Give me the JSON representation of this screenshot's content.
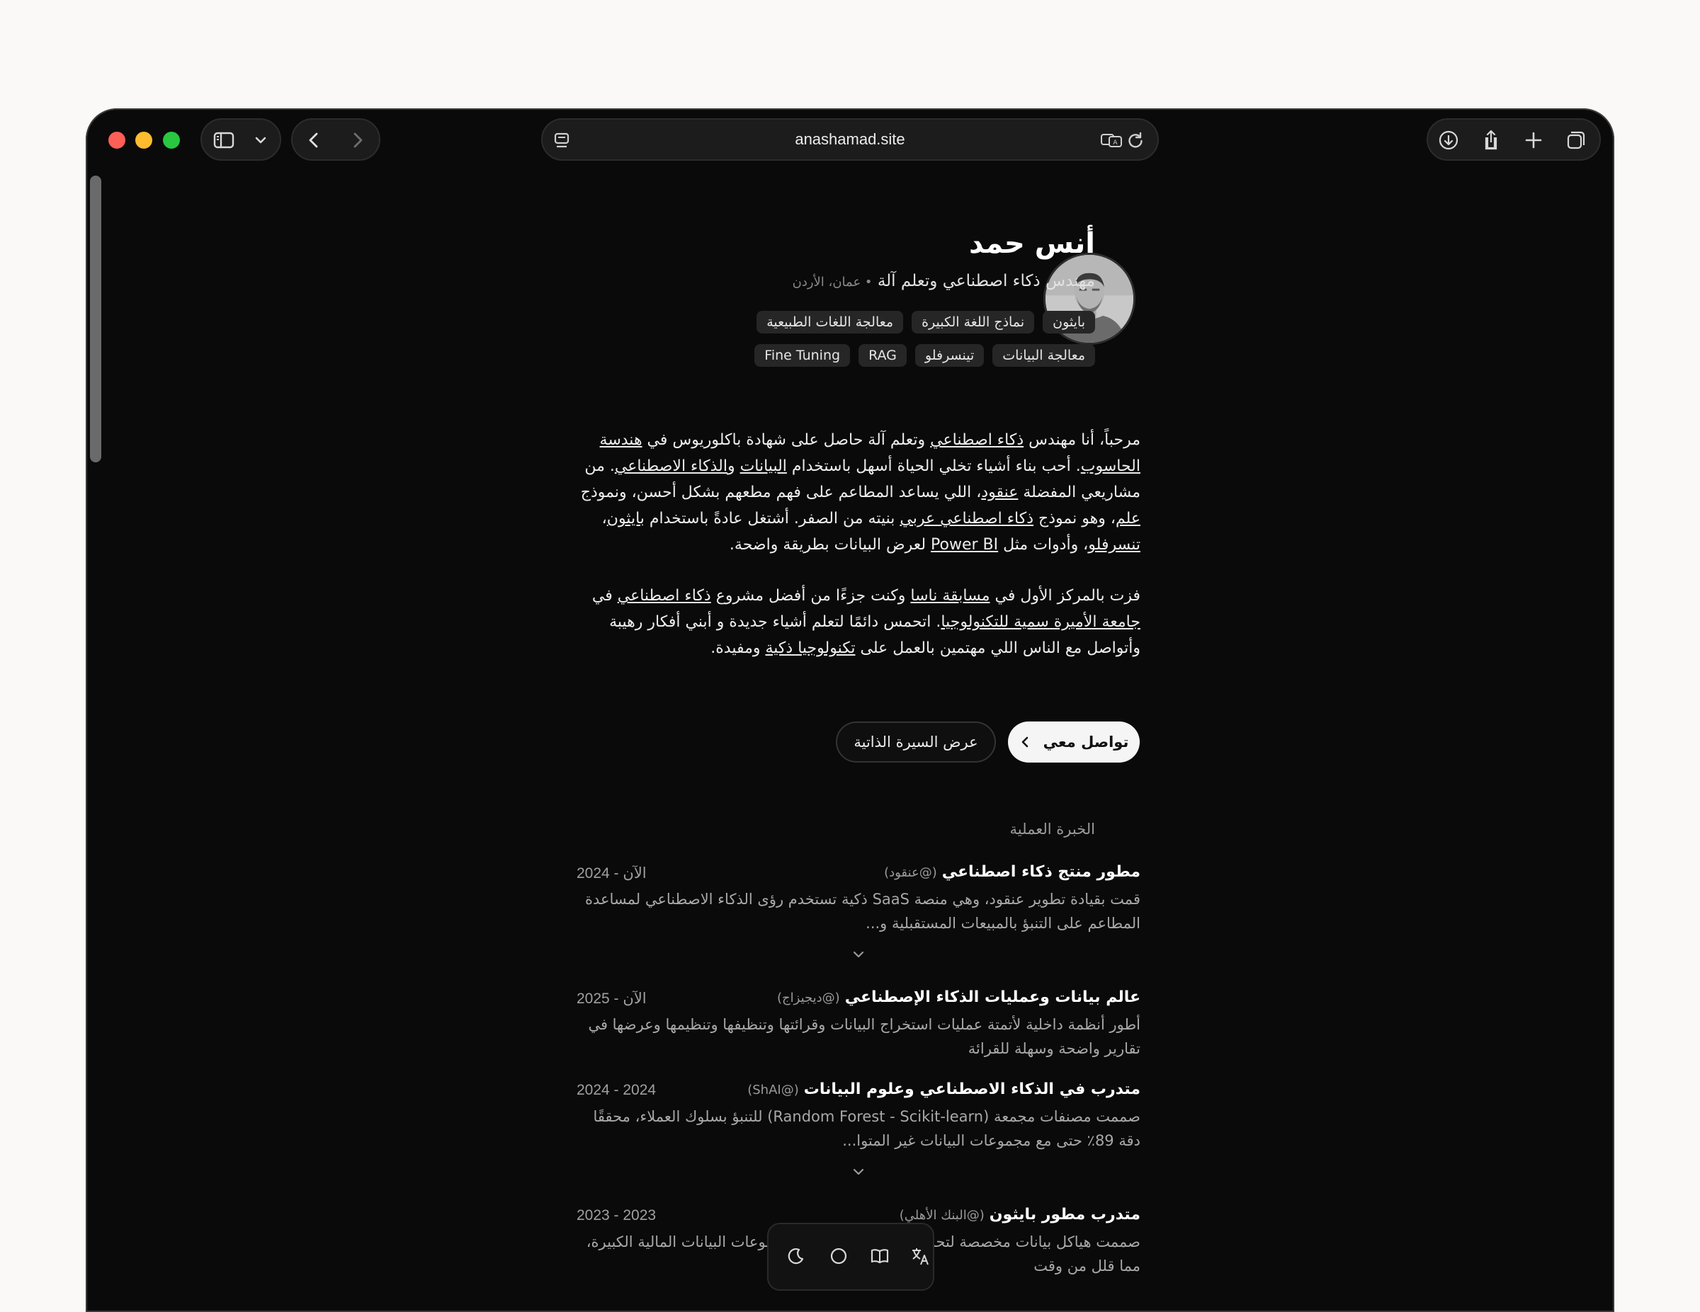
{
  "browser": {
    "url": "anashamad.site"
  },
  "profile": {
    "name": "أنس حمد",
    "role": "مهندس ذكاء اصطناعي وتعلم آلة",
    "location": "عمان، الأردن",
    "tags_row1": [
      "بايثون",
      "نماذج اللغة الكبيرة",
      "معالجة اللغات الطبيعية"
    ],
    "tags_row2": [
      "معالجة البيانات",
      "تينسرفلو",
      "RAG",
      "Fine Tuning"
    ]
  },
  "intro": {
    "p1": [
      {
        "t": "مرحباً، أنا مهندس "
      },
      {
        "t": "ذكاء اصطناعي",
        "u": true
      },
      {
        "t": " وتعلم آلة حاصل على شهادة باكلوريوس في "
      },
      {
        "t": "هندسة الحاسوب",
        "u": true
      },
      {
        "t": ". أحب بناء أشياء تخلي الحياة أسهل باستخدام "
      },
      {
        "t": "البيانات",
        "u": true
      },
      {
        "t": " و"
      },
      {
        "t": "الذكاء الاصطناعي",
        "u": true
      },
      {
        "t": ". من مشاريعي المفضلة "
      },
      {
        "t": "عنقود",
        "u": true
      },
      {
        "t": "، اللي يساعد المطاعم على فهم مطعهم بشكل أحسن، ونموذج "
      },
      {
        "t": "علم",
        "u": true
      },
      {
        "t": "، وهو نموذج "
      },
      {
        "t": "ذكاء اصطناعي عربي",
        "u": true
      },
      {
        "t": " بنيته من الصفر. أشتغل عادةً باستخدام "
      },
      {
        "t": "بايثون",
        "u": true
      },
      {
        "t": "، "
      },
      {
        "t": "تنسرفلو",
        "u": true
      },
      {
        "t": "، وأدوات مثل "
      },
      {
        "t": "Power BI",
        "u": true
      },
      {
        "t": " لعرض البيانات بطريقة واضحة."
      }
    ],
    "p2": [
      {
        "t": "فزت بالمركز الأول في "
      },
      {
        "t": "مسابقة ناسا",
        "u": true
      },
      {
        "t": " وكنت جزءًا من أفضل مشروع "
      },
      {
        "t": "ذكاء اصطناعي",
        "u": true
      },
      {
        "t": " في "
      },
      {
        "t": "جامعة الأميرة سمية للتكنولوجيا",
        "u": true
      },
      {
        "t": ". اتحمس دائمًا لتعلم أشياء جديدة و أبني أفكار رهيبة وأتواصل مع الناس اللي مهتمين بالعمل على "
      },
      {
        "t": "تكنولوجيا ذكية",
        "u": true
      },
      {
        "t": " ومفيدة."
      }
    ]
  },
  "buttons": {
    "contact": "تواصل معي",
    "cv": "عرض السيرة الذاتية"
  },
  "experience": {
    "title": "الخبرة العملية",
    "jobs": [
      {
        "title": "مطور منتج ذكاء اصطناعي",
        "company": "(@عنقود)",
        "date": "2024 - الآن",
        "desc": "قمت بقيادة تطوير عنقود، وهي منصة SaaS ذكية تستخدم رؤى الذكاء الاصطناعي لمساعدة المطاعم على التنبؤ بالمبيعات المستقبلية و..."
      },
      {
        "title": "عالم بيانات وعمليات الذكاء الإصطناعي",
        "company": "(@ديجيزاج)",
        "date": "2025 - الآن",
        "desc": "أطور أنظمة داخلية لأتمتة عمليات استخراج البيانات وقرائتها وتنظيفها وتنظيمها وعرضها في تقارير واضحة وسهلة للقرائة"
      },
      {
        "title": "متدرب في الذكاء الاصطناعي وعلوم البيانات",
        "company": "(@ShAI)",
        "date": "2024 - 2024",
        "desc": "صممت مصنفات مجمعة (Random Forest - Scikit-learn) للتنبؤ بسلوك العملاء، محققًا دقة 89٪ حتى مع مجموعات البيانات غير المتوا..."
      },
      {
        "title": "متدرب مطور بايثون",
        "company": "(@البنك الأهلي)",
        "date": "2023 - 2023",
        "desc": "صممت هياكل بيانات مخصصة لتحسين استخدام الذاكرة لمجموعات البيانات المالية الكبيرة، مما قلل من وقت"
      }
    ]
  }
}
